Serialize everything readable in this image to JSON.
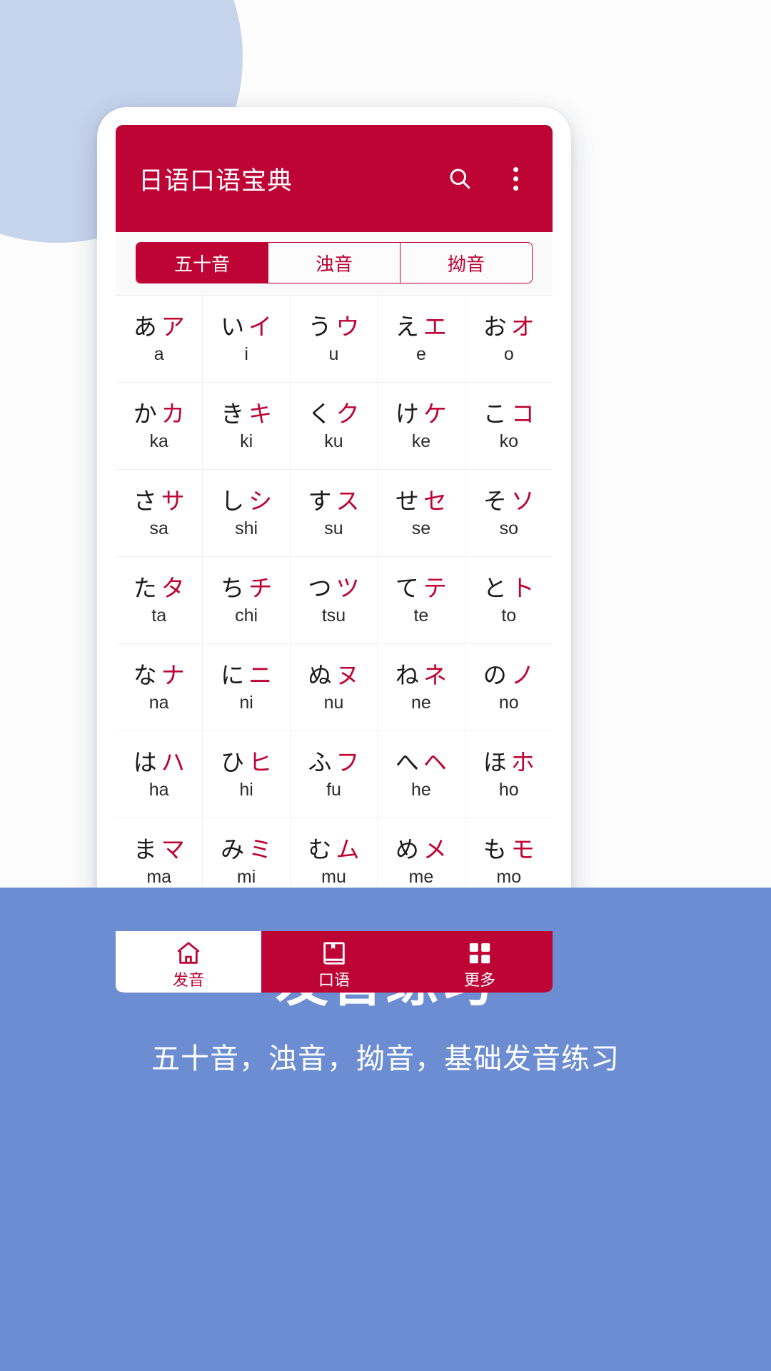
{
  "app": {
    "title": "日语口语宝典",
    "brand_red": "#bd0435",
    "banner_blue": "#6d8dd2",
    "blob_blue": "#c6d4ec"
  },
  "appbar": {
    "title": "日语口语宝典",
    "search_icon": "search-icon",
    "overflow_icon": "more-vertical-icon"
  },
  "tabs": [
    {
      "label": "五十音",
      "active": true
    },
    {
      "label": "浊音",
      "active": false
    },
    {
      "label": "拗音",
      "active": false
    }
  ],
  "kana_rows": [
    [
      {
        "hiragana": "あ",
        "katakana": "ア",
        "romaji": "a"
      },
      {
        "hiragana": "い",
        "katakana": "イ",
        "romaji": "i"
      },
      {
        "hiragana": "う",
        "katakana": "ウ",
        "romaji": "u"
      },
      {
        "hiragana": "え",
        "katakana": "エ",
        "romaji": "e"
      },
      {
        "hiragana": "お",
        "katakana": "オ",
        "romaji": "o"
      }
    ],
    [
      {
        "hiragana": "か",
        "katakana": "カ",
        "romaji": "ka"
      },
      {
        "hiragana": "き",
        "katakana": "キ",
        "romaji": "ki"
      },
      {
        "hiragana": "く",
        "katakana": "ク",
        "romaji": "ku"
      },
      {
        "hiragana": "け",
        "katakana": "ケ",
        "romaji": "ke"
      },
      {
        "hiragana": "こ",
        "katakana": "コ",
        "romaji": "ko"
      }
    ],
    [
      {
        "hiragana": "さ",
        "katakana": "サ",
        "romaji": "sa"
      },
      {
        "hiragana": "し",
        "katakana": "シ",
        "romaji": "shi"
      },
      {
        "hiragana": "す",
        "katakana": "ス",
        "romaji": "su"
      },
      {
        "hiragana": "せ",
        "katakana": "セ",
        "romaji": "se"
      },
      {
        "hiragana": "そ",
        "katakana": "ソ",
        "romaji": "so"
      }
    ],
    [
      {
        "hiragana": "た",
        "katakana": "タ",
        "romaji": "ta"
      },
      {
        "hiragana": "ち",
        "katakana": "チ",
        "romaji": "chi"
      },
      {
        "hiragana": "つ",
        "katakana": "ツ",
        "romaji": "tsu"
      },
      {
        "hiragana": "て",
        "katakana": "テ",
        "romaji": "te"
      },
      {
        "hiragana": "と",
        "katakana": "ト",
        "romaji": "to"
      }
    ],
    [
      {
        "hiragana": "な",
        "katakana": "ナ",
        "romaji": "na"
      },
      {
        "hiragana": "に",
        "katakana": "ニ",
        "romaji": "ni"
      },
      {
        "hiragana": "ぬ",
        "katakana": "ヌ",
        "romaji": "nu"
      },
      {
        "hiragana": "ね",
        "katakana": "ネ",
        "romaji": "ne"
      },
      {
        "hiragana": "の",
        "katakana": "ノ",
        "romaji": "no"
      }
    ],
    [
      {
        "hiragana": "は",
        "katakana": "ハ",
        "romaji": "ha"
      },
      {
        "hiragana": "ひ",
        "katakana": "ヒ",
        "romaji": "hi"
      },
      {
        "hiragana": "ふ",
        "katakana": "フ",
        "romaji": "fu"
      },
      {
        "hiragana": "へ",
        "katakana": "ヘ",
        "romaji": "he"
      },
      {
        "hiragana": "ほ",
        "katakana": "ホ",
        "romaji": "ho"
      }
    ],
    [
      {
        "hiragana": "ま",
        "katakana": "マ",
        "romaji": "ma"
      },
      {
        "hiragana": "み",
        "katakana": "ミ",
        "romaji": "mi"
      },
      {
        "hiragana": "む",
        "katakana": "ム",
        "romaji": "mu"
      },
      {
        "hiragana": "め",
        "katakana": "メ",
        "romaji": "me"
      },
      {
        "hiragana": "も",
        "katakana": "モ",
        "romaji": "mo"
      }
    ]
  ],
  "bottom_nav": [
    {
      "label": "发音",
      "icon": "home-icon",
      "active": false
    },
    {
      "label": "口语",
      "icon": "book-icon",
      "active": true
    },
    {
      "label": "更多",
      "icon": "grid-icon",
      "active": true
    }
  ],
  "banner": {
    "title": "发音练习",
    "subtitle": "五十音，浊音，拗音，基础发音练习"
  }
}
